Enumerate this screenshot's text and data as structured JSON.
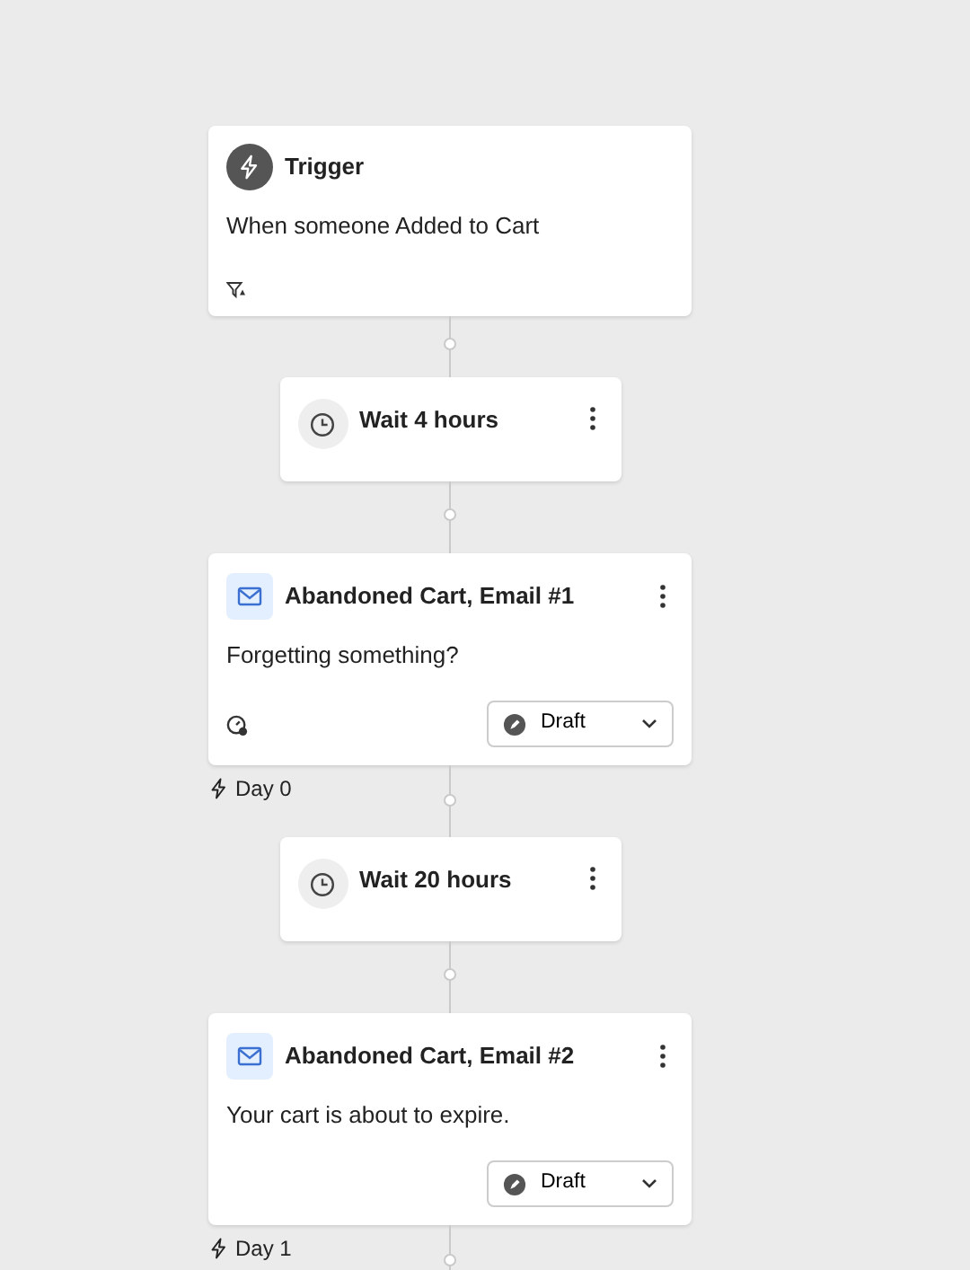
{
  "steps": [
    {
      "kind": "trigger",
      "title": "Trigger",
      "description": "When someone Added to Cart"
    },
    {
      "kind": "wait",
      "title": "Wait 4 hours"
    },
    {
      "kind": "email",
      "title": "Abandoned Cart, Email #1",
      "description": "Forgetting something?",
      "status_icon": true,
      "status": "Draft",
      "day_label": "Day 0"
    },
    {
      "kind": "wait",
      "title": "Wait 20 hours"
    },
    {
      "kind": "email",
      "title": "Abandoned Cart, Email #2",
      "description": "Your cart is about to expire.",
      "status_icon": false,
      "status": "Draft",
      "day_label": "Day 1"
    }
  ]
}
